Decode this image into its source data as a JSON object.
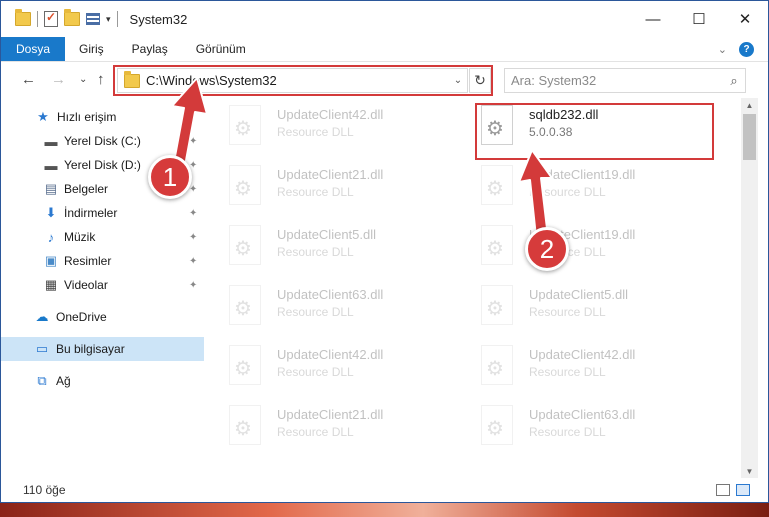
{
  "window": {
    "title": "System32"
  },
  "window_controls": {
    "minimize": "—",
    "maximize": "☐",
    "close": "✕"
  },
  "ribbon": {
    "tabs": [
      {
        "label": "Dosya"
      },
      {
        "label": "Giriş"
      },
      {
        "label": "Paylaş"
      },
      {
        "label": "Görünüm"
      }
    ],
    "expand_glyph": "⌄",
    "help_glyph": "?"
  },
  "nav": {
    "back": "←",
    "forward": "→",
    "recent": "⌄",
    "up": "↑",
    "address": "C:\\Windows\\System32",
    "address_dropdown": "⌄",
    "refresh": "↻",
    "search_placeholder": "Ara: System32",
    "search_glyph": "⌕"
  },
  "sidebar": {
    "items": [
      {
        "label": "Hızlı erişim",
        "icon": "star-icon",
        "glyph": "★",
        "color": "#2b79d0"
      },
      {
        "label": "Yerel Disk (C:)",
        "icon": "drive-icon",
        "glyph": "▬",
        "color": "#555555",
        "pinned": true
      },
      {
        "label": "Yerel Disk (D:)",
        "icon": "drive-icon",
        "glyph": "▬",
        "color": "#555555",
        "pinned": true
      },
      {
        "label": "Belgeler",
        "icon": "documents-icon",
        "glyph": "▤",
        "color": "#5a6f8f",
        "pinned": true
      },
      {
        "label": "İndirmeler",
        "icon": "download-icon",
        "glyph": "⬇",
        "color": "#2b79d0",
        "pinned": true
      },
      {
        "label": "Müzik",
        "icon": "music-icon",
        "glyph": "♪",
        "color": "#2b79d0",
        "pinned": true
      },
      {
        "label": "Resimler",
        "icon": "pictures-icon",
        "glyph": "▣",
        "color": "#4a8bc9",
        "pinned": true
      },
      {
        "label": "Videolar",
        "icon": "videos-icon",
        "glyph": "▦",
        "color": "#444444",
        "pinned": true
      },
      {
        "label": "OneDrive",
        "icon": "cloud-icon",
        "glyph": "☁",
        "color": "#1979ca"
      },
      {
        "label": "Bu bilgisayar",
        "icon": "computer-icon",
        "glyph": "▭",
        "color": "#2b79d0",
        "selected": true
      },
      {
        "label": "Ağ",
        "icon": "network-icon",
        "glyph": "⧉",
        "color": "#2b79d0"
      }
    ],
    "pin_glyph": "📌"
  },
  "files": [
    {
      "name": "UpdateClient42.dll",
      "type": "Resource DLL",
      "faded": true
    },
    {
      "name": "sqldb232.dll",
      "type": "5.0.0.38",
      "faded": false,
      "highlighted": true
    },
    {
      "name": "UpdateClient21.dll",
      "type": "Resource DLL",
      "faded": true
    },
    {
      "name": "UpdateClient19.dll",
      "type": "Resource DLL",
      "faded": true
    },
    {
      "name": "UpdateClient5.dll",
      "type": "Resource DLL",
      "faded": true
    },
    {
      "name": "UpdateClient19.dll",
      "type": "Resource DLL",
      "faded": true
    },
    {
      "name": "UpdateClient63.dll",
      "type": "Resource DLL",
      "faded": true
    },
    {
      "name": "UpdateClient5.dll",
      "type": "Resource DLL",
      "faded": true
    },
    {
      "name": "UpdateClient42.dll",
      "type": "Resource DLL",
      "faded": true
    },
    {
      "name": "UpdateClient42.dll",
      "type": "Resource DLL",
      "faded": true
    },
    {
      "name": "UpdateClient21.dll",
      "type": "Resource DLL",
      "faded": true
    },
    {
      "name": "UpdateClient63.dll",
      "type": "Resource DLL",
      "faded": true
    }
  ],
  "status": {
    "count": "110 öğe"
  },
  "annotations": {
    "step1": "1",
    "step2": "2",
    "color": "#d33a3a"
  }
}
